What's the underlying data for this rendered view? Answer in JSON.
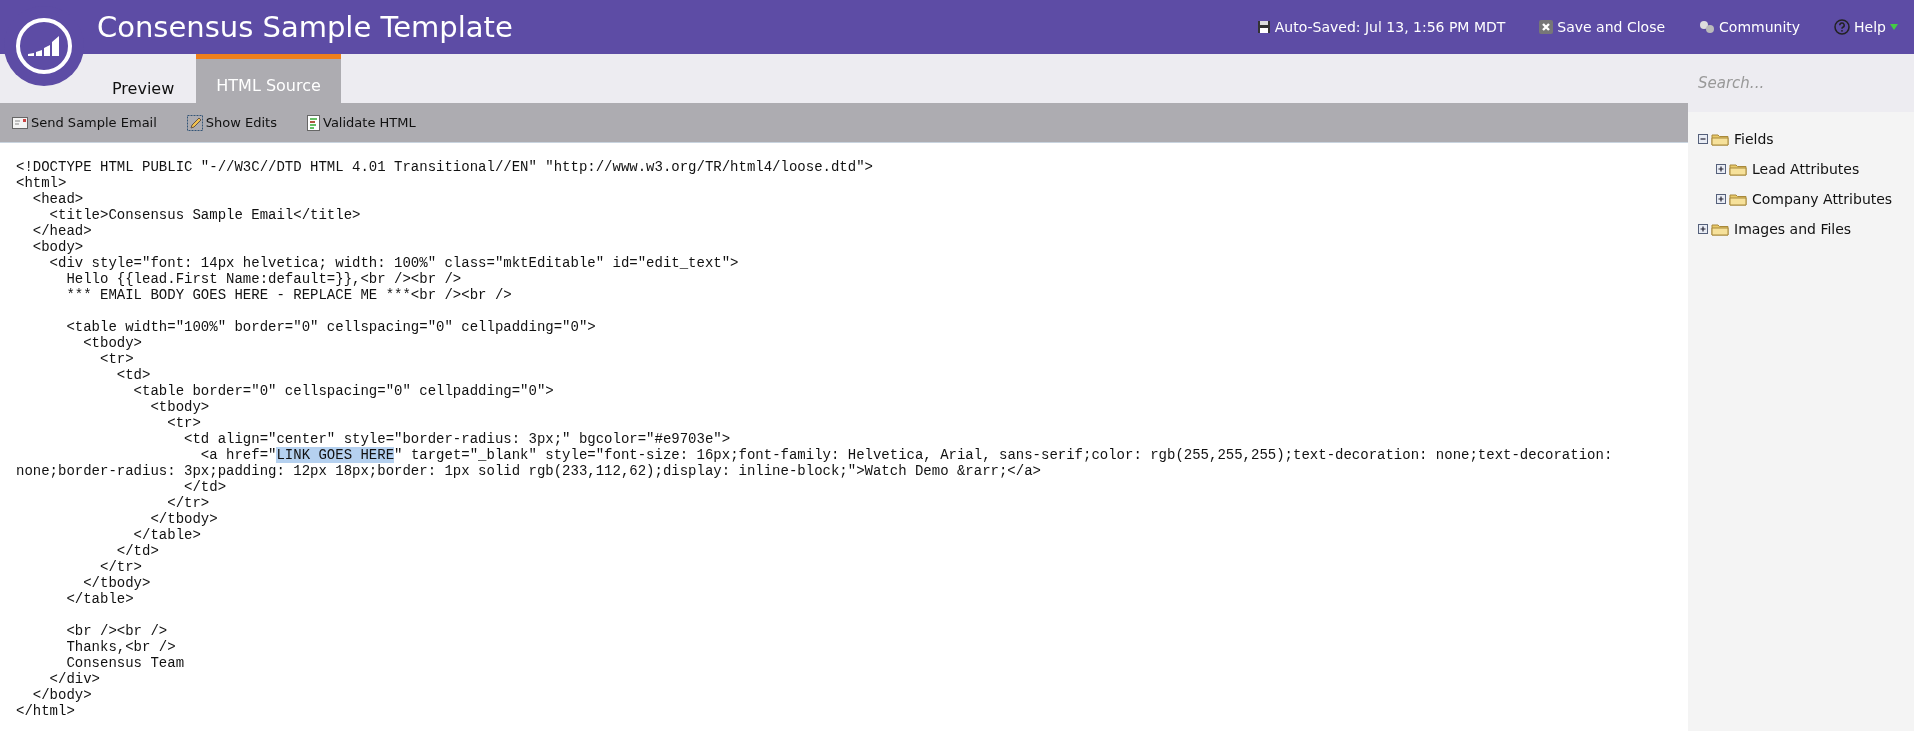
{
  "header": {
    "title": "Consensus Sample Template",
    "actions": [
      {
        "kind": "autosave",
        "label": "Auto-Saved: Jul 13, 1:56 PM MDT"
      },
      {
        "kind": "close",
        "label": "Save and Close"
      },
      {
        "kind": "community",
        "label": "Community"
      },
      {
        "kind": "help",
        "label": "Help"
      }
    ]
  },
  "tabs": [
    {
      "label": "Preview",
      "selected": false
    },
    {
      "label": "HTML Source",
      "selected": true
    }
  ],
  "toolbar": [
    {
      "kind": "email",
      "label": "Send Sample Email"
    },
    {
      "kind": "edits",
      "label": "Show Edits"
    },
    {
      "kind": "validate",
      "label": "Validate HTML"
    }
  ],
  "search": {
    "placeholder": "Search..."
  },
  "tree": [
    {
      "label": "Fields",
      "expanded": true,
      "children": [
        {
          "label": "Lead Attributes",
          "expanded": false
        },
        {
          "label": "Company Attributes",
          "expanded": false
        }
      ]
    },
    {
      "label": "Images and Files",
      "expanded": false
    }
  ],
  "code_lines": [
    {
      "kind": "code",
      "text": "<!DOCTYPE HTML PUBLIC \"-//W3C//DTD HTML 4.01 Transitional//EN\" \"http://www.w3.org/TR/html4/loose.dtd\">"
    },
    {
      "kind": "code",
      "text": "<html>"
    },
    {
      "kind": "code",
      "text": "  <head>"
    },
    {
      "kind": "code",
      "text": "    <title>Consensus Sample Email</title>"
    },
    {
      "kind": "code",
      "text": "  </head>"
    },
    {
      "kind": "code",
      "text": "  <body>"
    },
    {
      "kind": "code",
      "text": "    <div style=\"font: 14px helvetica; width: 100%\" class=\"mktEditable\" id=\"edit_text\">"
    },
    {
      "kind": "code",
      "text": "      Hello {{lead.First Name:default=}},<br /><br />"
    },
    {
      "kind": "code",
      "text": "      *** EMAIL BODY GOES HERE - REPLACE ME ***<br /><br />"
    },
    {
      "kind": "blank"
    },
    {
      "kind": "code",
      "text": "      <table width=\"100%\" border=\"0\" cellspacing=\"0\" cellpadding=\"0\">"
    },
    {
      "kind": "code",
      "text": "        <tbody>"
    },
    {
      "kind": "code",
      "text": "          <tr>"
    },
    {
      "kind": "code",
      "text": "            <td>"
    },
    {
      "kind": "code",
      "text": "              <table border=\"0\" cellspacing=\"0\" cellpadding=\"0\">"
    },
    {
      "kind": "code",
      "text": "                <tbody>"
    },
    {
      "kind": "code",
      "text": "                  <tr>"
    },
    {
      "kind": "code",
      "text": "                    <td align=\"center\" style=\"border-radius: 3px;\" bgcolor=\"#e9703e\">"
    },
    {
      "kind": "segmented",
      "segments": [
        {
          "text": "                      <a href=\"",
          "selected": false
        },
        {
          "text": "LINK GOES HERE",
          "selected": true
        },
        {
          "text": "\" target=\"_blank\" style=\"font-size: 16px;font-family: Helvetica, Arial, sans-serif;color: rgb(255,255,255);text-decoration: none;text-decoration:",
          "selected": false
        }
      ]
    },
    {
      "kind": "code",
      "text": "none;border-radius: 3px;padding: 12px 18px;border: 1px solid rgb(233,112,62);display: inline-block;\">Watch Demo &rarr;</a>"
    },
    {
      "kind": "code",
      "text": "                    </td>"
    },
    {
      "kind": "code",
      "text": "                  </tr>"
    },
    {
      "kind": "code",
      "text": "                </tbody>"
    },
    {
      "kind": "code",
      "text": "              </table>"
    },
    {
      "kind": "code",
      "text": "            </td>"
    },
    {
      "kind": "code",
      "text": "          </tr>"
    },
    {
      "kind": "code",
      "text": "        </tbody>"
    },
    {
      "kind": "code",
      "text": "      </table>"
    },
    {
      "kind": "blank"
    },
    {
      "kind": "code",
      "text": "      <br /><br />"
    },
    {
      "kind": "code",
      "text": "      Thanks,<br />"
    },
    {
      "kind": "code",
      "text": "      Consensus Team"
    },
    {
      "kind": "code",
      "text": "    </div>"
    },
    {
      "kind": "code",
      "text": "  </body>"
    },
    {
      "kind": "code",
      "text": "</html>"
    }
  ]
}
